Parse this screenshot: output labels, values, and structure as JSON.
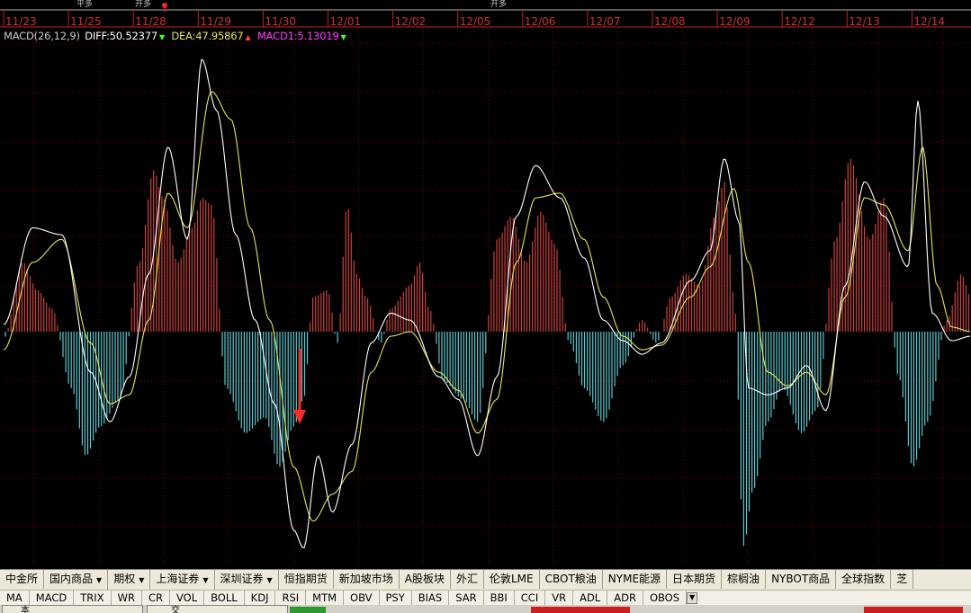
{
  "chart": {
    "legend": {
      "name": "MACD(26,12,9)",
      "diff": "DIFF:50.52377",
      "diff_arrow": "▼",
      "dea": "DEA:47.95867",
      "dea_arrow": "▲",
      "macd": "MACD1:5.13019",
      "macd_arrow": "▼"
    },
    "top_annotations": [
      "平多",
      "开多",
      "开多"
    ],
    "date_labels": [
      "11/23",
      "11/25",
      "11/28",
      "11/29",
      "11/30",
      "12/01",
      "12/02",
      "12/05",
      "12/06",
      "12/07",
      "12/08",
      "12/09",
      "12/12",
      "12/13",
      "12/14"
    ],
    "colors": {
      "background": "#000000",
      "grid": "#7a0000",
      "positive_bar": "#c8433e",
      "negative_bar": "#5cc8d0",
      "diff_line": "#ffffff",
      "dea_line": "#e6e65a",
      "signal_arrow": "#ff2a2a",
      "legend_name": "#c8c8c8",
      "legend_diff": "#ffffff",
      "legend_dea": "#e6e65a",
      "legend_macd": "#ff40ff",
      "legend_arrow_down": "#40ff40",
      "legend_arrow_up": "#ff4040"
    }
  },
  "chart_data": {
    "type": "bar",
    "title": "MACD(26,12,9)",
    "xlabel": "",
    "ylabel": "",
    "x_tick_labels": [
      "11/23",
      "11/25",
      "11/28",
      "11/29",
      "11/30",
      "12/01",
      "12/02",
      "12/05",
      "12/06",
      "12/07",
      "12/08",
      "12/09",
      "12/12",
      "12/13",
      "12/14"
    ],
    "ylim": [
      -100,
      125
    ],
    "grid": true,
    "series": [
      {
        "name": "DIFF",
        "style": "line",
        "keypoints": [
          [
            0,
            3
          ],
          [
            0.03,
            45
          ],
          [
            0.06,
            42
          ],
          [
            0.09,
            -18
          ],
          [
            0.11,
            -40
          ],
          [
            0.13,
            -20
          ],
          [
            0.15,
            25
          ],
          [
            0.17,
            80
          ],
          [
            0.19,
            40
          ],
          [
            0.205,
            118
          ],
          [
            0.22,
            96
          ],
          [
            0.24,
            42
          ],
          [
            0.26,
            5
          ],
          [
            0.28,
            -32
          ],
          [
            0.3,
            -88
          ],
          [
            0.31,
            -96
          ],
          [
            0.325,
            -55
          ],
          [
            0.34,
            -80
          ],
          [
            0.36,
            -50
          ],
          [
            0.38,
            -5
          ],
          [
            0.4,
            8
          ],
          [
            0.42,
            5
          ],
          [
            0.45,
            -20
          ],
          [
            0.47,
            -30
          ],
          [
            0.49,
            -55
          ],
          [
            0.51,
            -20
          ],
          [
            0.53,
            50
          ],
          [
            0.55,
            72
          ],
          [
            0.575,
            58
          ],
          [
            0.6,
            32
          ],
          [
            0.62,
            5
          ],
          [
            0.64,
            -4
          ],
          [
            0.66,
            -10
          ],
          [
            0.68,
            -5
          ],
          [
            0.71,
            22
          ],
          [
            0.73,
            35
          ],
          [
            0.745,
            75
          ],
          [
            0.76,
            48
          ],
          [
            0.77,
            -25
          ],
          [
            0.79,
            -28
          ],
          [
            0.81,
            -25
          ],
          [
            0.83,
            -15
          ],
          [
            0.85,
            -35
          ],
          [
            0.87,
            20
          ],
          [
            0.89,
            65
          ],
          [
            0.91,
            50
          ],
          [
            0.935,
            28
          ],
          [
            0.945,
            100
          ],
          [
            0.96,
            8
          ],
          [
            0.98,
            -4
          ],
          [
            1.0,
            -2
          ]
        ]
      },
      {
        "name": "DEA",
        "style": "line",
        "keypoints": [
          [
            0,
            -8
          ],
          [
            0.03,
            30
          ],
          [
            0.06,
            40
          ],
          [
            0.09,
            -5
          ],
          [
            0.11,
            -32
          ],
          [
            0.13,
            -28
          ],
          [
            0.15,
            5
          ],
          [
            0.17,
            60
          ],
          [
            0.19,
            45
          ],
          [
            0.215,
            104
          ],
          [
            0.235,
            92
          ],
          [
            0.255,
            45
          ],
          [
            0.275,
            5
          ],
          [
            0.3,
            -60
          ],
          [
            0.32,
            -84
          ],
          [
            0.34,
            -72
          ],
          [
            0.36,
            -62
          ],
          [
            0.38,
            -18
          ],
          [
            0.4,
            -2
          ],
          [
            0.42,
            0
          ],
          [
            0.45,
            -18
          ],
          [
            0.47,
            -26
          ],
          [
            0.49,
            -45
          ],
          [
            0.51,
            -30
          ],
          [
            0.53,
            30
          ],
          [
            0.55,
            58
          ],
          [
            0.575,
            60
          ],
          [
            0.6,
            40
          ],
          [
            0.62,
            15
          ],
          [
            0.64,
            -2
          ],
          [
            0.66,
            -8
          ],
          [
            0.68,
            -6
          ],
          [
            0.71,
            15
          ],
          [
            0.73,
            28
          ],
          [
            0.755,
            62
          ],
          [
            0.77,
            30
          ],
          [
            0.79,
            -18
          ],
          [
            0.81,
            -24
          ],
          [
            0.83,
            -18
          ],
          [
            0.85,
            -28
          ],
          [
            0.87,
            15
          ],
          [
            0.89,
            58
          ],
          [
            0.91,
            55
          ],
          [
            0.935,
            35
          ],
          [
            0.95,
            80
          ],
          [
            0.965,
            20
          ],
          [
            0.98,
            2
          ],
          [
            1.0,
            0
          ]
        ]
      },
      {
        "name": "MACD1",
        "style": "bar",
        "keypoints": [
          [
            0,
            -3
          ],
          [
            0.02,
            30
          ],
          [
            0.035,
            18
          ],
          [
            0.05,
            10
          ],
          [
            0.07,
            -25
          ],
          [
            0.085,
            -55
          ],
          [
            0.1,
            -42
          ],
          [
            0.12,
            -30
          ],
          [
            0.14,
            30
          ],
          [
            0.155,
            70
          ],
          [
            0.165,
            58
          ],
          [
            0.18,
            30
          ],
          [
            0.195,
            45
          ],
          [
            0.205,
            58
          ],
          [
            0.215,
            55
          ],
          [
            0.23,
            -25
          ],
          [
            0.25,
            -45
          ],
          [
            0.27,
            -38
          ],
          [
            0.285,
            -60
          ],
          [
            0.3,
            -42
          ],
          [
            0.31,
            -30
          ],
          [
            0.32,
            15
          ],
          [
            0.335,
            18
          ],
          [
            0.345,
            -5
          ],
          [
            0.355,
            55
          ],
          [
            0.365,
            25
          ],
          [
            0.375,
            15
          ],
          [
            0.39,
            -5
          ],
          [
            0.4,
            10
          ],
          [
            0.42,
            20
          ],
          [
            0.43,
            30
          ],
          [
            0.44,
            10
          ],
          [
            0.455,
            -22
          ],
          [
            0.475,
            -30
          ],
          [
            0.49,
            -40
          ],
          [
            0.51,
            40
          ],
          [
            0.525,
            50
          ],
          [
            0.54,
            30
          ],
          [
            0.555,
            52
          ],
          [
            0.57,
            38
          ],
          [
            0.585,
            -5
          ],
          [
            0.6,
            -25
          ],
          [
            0.62,
            -40
          ],
          [
            0.64,
            -15
          ],
          [
            0.66,
            5
          ],
          [
            0.675,
            -5
          ],
          [
            0.69,
            15
          ],
          [
            0.705,
            25
          ],
          [
            0.72,
            20
          ],
          [
            0.735,
            50
          ],
          [
            0.745,
            65
          ],
          [
            0.755,
            15
          ],
          [
            0.765,
            -95
          ],
          [
            0.775,
            -70
          ],
          [
            0.79,
            -40
          ],
          [
            0.805,
            -25
          ],
          [
            0.825,
            -45
          ],
          [
            0.84,
            -35
          ],
          [
            0.86,
            40
          ],
          [
            0.875,
            75
          ],
          [
            0.895,
            40
          ],
          [
            0.91,
            58
          ],
          [
            0.925,
            -20
          ],
          [
            0.94,
            -60
          ],
          [
            0.955,
            -40
          ],
          [
            0.975,
            5
          ],
          [
            0.99,
            25
          ],
          [
            1.0,
            15
          ]
        ]
      }
    ]
  },
  "market_tabs": [
    {
      "label": "中金所",
      "dropdown": false
    },
    {
      "label": "国内商品",
      "dropdown": true
    },
    {
      "label": "期权",
      "dropdown": true
    },
    {
      "label": "上海证券",
      "dropdown": true
    },
    {
      "label": "深圳证券",
      "dropdown": true
    },
    {
      "label": "恒指期货",
      "dropdown": false
    },
    {
      "label": "新加坡市场",
      "dropdown": false
    },
    {
      "label": "A股板块",
      "dropdown": false
    },
    {
      "label": "外汇",
      "dropdown": false
    },
    {
      "label": "伦敦LME",
      "dropdown": false
    },
    {
      "label": "CBOT粮油",
      "dropdown": false
    },
    {
      "label": "NYME能源",
      "dropdown": false
    },
    {
      "label": "日本期货",
      "dropdown": false
    },
    {
      "label": "棕榈油",
      "dropdown": false
    },
    {
      "label": "NYBOT商品",
      "dropdown": false
    },
    {
      "label": "全球指数",
      "dropdown": false
    },
    {
      "label": "芝",
      "dropdown": false
    }
  ],
  "indicator_tabs": [
    "MA",
    "MACD",
    "TRIX",
    "WR",
    "CR",
    "VOL",
    "BOLL",
    "KDJ",
    "RSI",
    "MTM",
    "OBV",
    "PSY",
    "BIAS",
    "SAR",
    "BBI",
    "CCI",
    "VR",
    "ADL",
    "ADR",
    "OBOS"
  ],
  "taskbar": {
    "window1_label": "本",
    "window2_label": "交"
  }
}
